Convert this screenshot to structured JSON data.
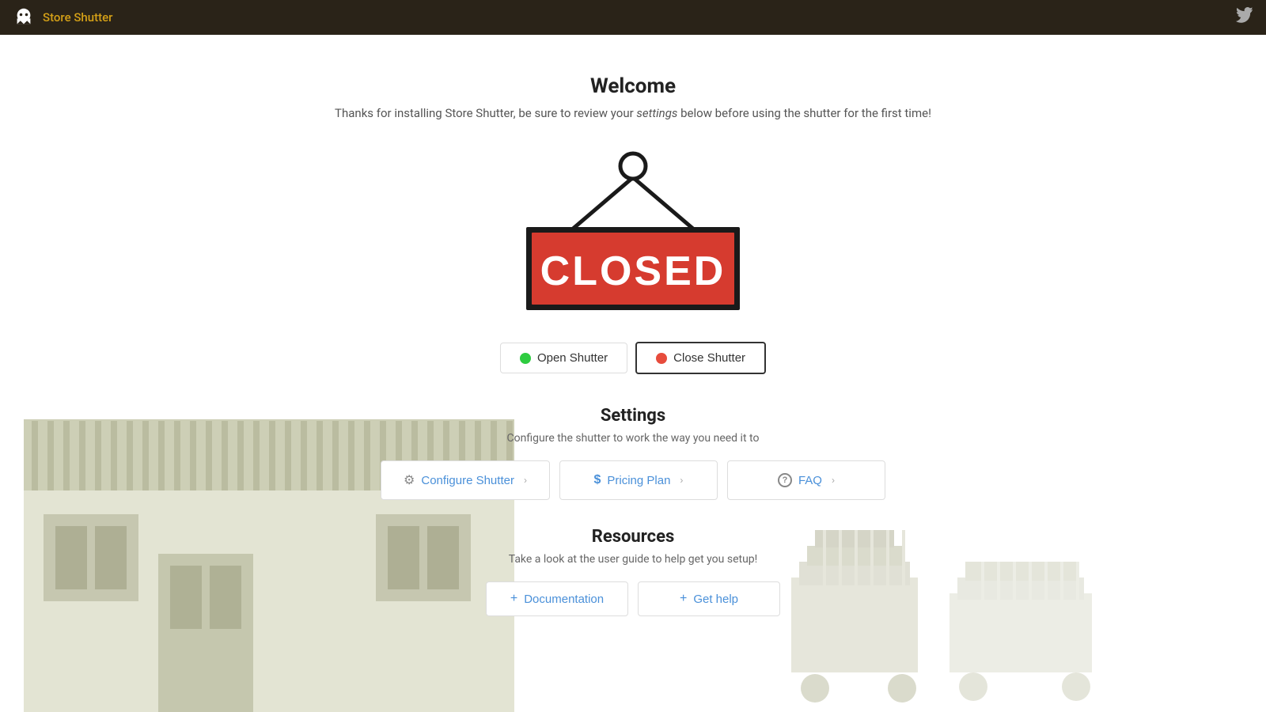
{
  "header": {
    "logo_alt": "Store Shutter Logo",
    "title": "Store Shutter",
    "twitter_icon": "🐦"
  },
  "welcome": {
    "title": "Welcome",
    "subtitle_before": "Thanks for installing Store Shutter, be sure to review your ",
    "subtitle_italic": "settings",
    "subtitle_after": " below before using the shutter for the first time!"
  },
  "sign": {
    "closed_text": "CLOSED"
  },
  "shutter_controls": {
    "open_label": "Open Shutter",
    "close_label": "Close Shutter"
  },
  "settings": {
    "title": "Settings",
    "subtitle": "Configure the shutter to work the way you need it to",
    "buttons": [
      {
        "id": "configure",
        "icon": "⚙",
        "label": "Configure Shutter"
      },
      {
        "id": "pricing",
        "icon": "$",
        "label": "Pricing Plan"
      },
      {
        "id": "faq",
        "icon": "?",
        "label": "FAQ"
      }
    ]
  },
  "resources": {
    "title": "Resources",
    "subtitle": "Take a look at the user guide to help get you setup!",
    "buttons": [
      {
        "id": "documentation",
        "label": "Documentation"
      },
      {
        "id": "get-help",
        "label": "Get help"
      }
    ]
  }
}
